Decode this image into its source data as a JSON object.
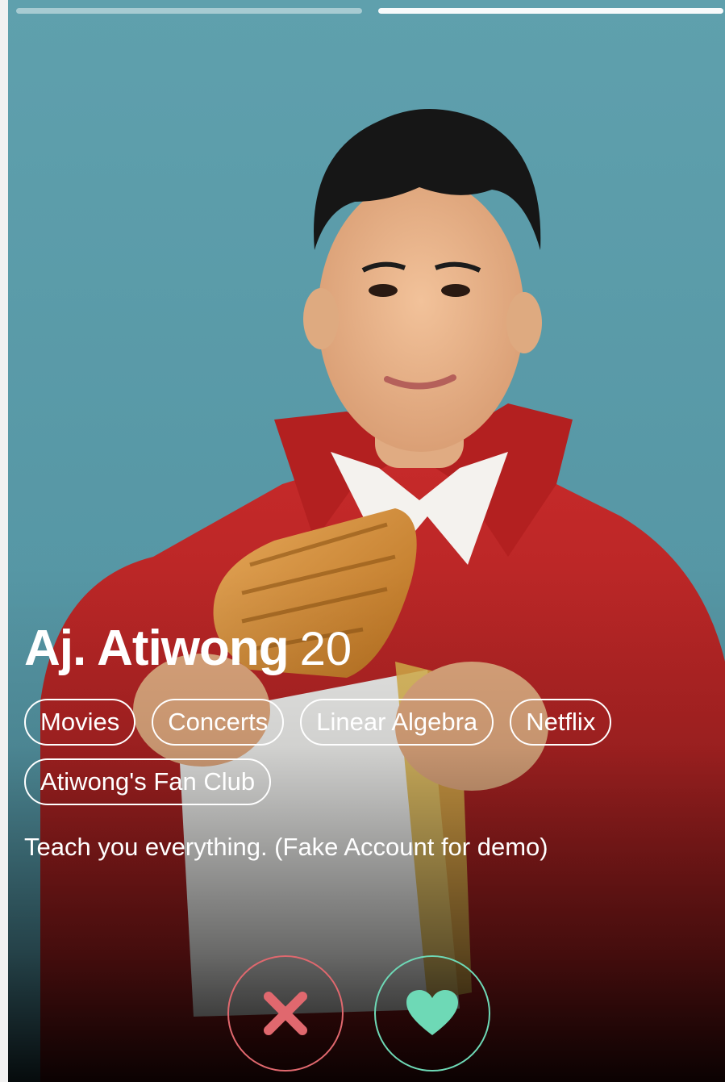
{
  "progress": {
    "segments": 2,
    "active_index": 1
  },
  "profile": {
    "name": "Aj. Atiwong",
    "age": "20",
    "tags": [
      "Movies",
      "Concerts",
      "Linear Algebra",
      "Netflix",
      "Atiwong's Fan Club"
    ],
    "bio": "Teach you everything. (Fake Account for demo)"
  },
  "actions": {
    "nope_icon": "close-icon",
    "like_icon": "heart-icon"
  },
  "colors": {
    "background": "#5fa0ad",
    "nope": "#e0686e",
    "like": "#6ed9b6"
  }
}
